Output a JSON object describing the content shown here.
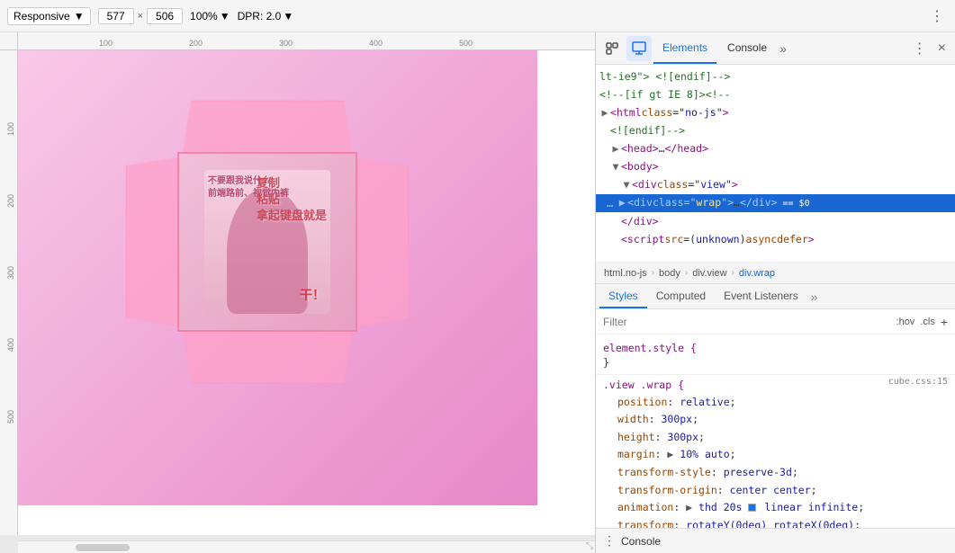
{
  "toolbar": {
    "responsive_label": "Responsive",
    "width_val": "577",
    "height_val": "506",
    "zoom_label": "100%",
    "dpr_label": "DPR: 2.0"
  },
  "devtools": {
    "tabs": [
      {
        "id": "elements",
        "label": "Elements",
        "active": true
      },
      {
        "id": "console",
        "label": "Console",
        "active": false
      }
    ],
    "more_label": "»",
    "close_label": "×",
    "html_tree": [
      {
        "indent": 0,
        "content": "lt-ie9\"> <!--[endif]-->",
        "type": "comment",
        "expanded": false
      },
      {
        "indent": 0,
        "content": "<!--[if gt IE 8]><!--",
        "type": "comment",
        "expanded": false
      },
      {
        "indent": 0,
        "tag": "html",
        "attrs": [
          {
            "name": "class",
            "val": "no-js"
          }
        ],
        "type": "open",
        "expanded": false
      },
      {
        "indent": 1,
        "content": "<!--[endif]-->",
        "type": "comment",
        "expanded": false
      },
      {
        "indent": 1,
        "tag": "head",
        "self": "…</head>",
        "type": "collapsed",
        "expanded": false
      },
      {
        "indent": 1,
        "tag": "body",
        "type": "open",
        "expanded": true,
        "toggle": "▼"
      },
      {
        "indent": 2,
        "tag": "div",
        "attrs": [
          {
            "name": "class",
            "val": "view"
          }
        ],
        "type": "open",
        "expanded": true,
        "toggle": "▼"
      },
      {
        "indent": 3,
        "tag": "div",
        "attrs": [
          {
            "name": "class",
            "val": "wrap"
          }
        ],
        "self": "…</div>",
        "type": "collapsed",
        "selected": true,
        "marker": "== $0"
      },
      {
        "indent": 2,
        "content": "</div>",
        "type": "close"
      },
      {
        "indent": 2,
        "tag": "script",
        "attrs": [
          {
            "name": "src",
            "val": "unknown"
          },
          {
            "name2": "async"
          },
          {
            "name3": "defer"
          }
        ],
        "type": "open"
      }
    ],
    "breadcrumb": [
      {
        "label": "html.no-js"
      },
      {
        "label": "body"
      },
      {
        "label": "div.view"
      },
      {
        "label": "div.wrap",
        "current": true
      }
    ],
    "styles_tabs": [
      {
        "label": "Styles",
        "active": true
      },
      {
        "label": "Computed",
        "active": false
      },
      {
        "label": "Event Listeners",
        "active": false
      }
    ],
    "filter_placeholder": "Filter",
    "filter_hov": ":hov",
    "filter_cls": ".cls",
    "filter_plus": "+",
    "css_rules": [
      {
        "selector": "element.style {",
        "close": "}",
        "props": []
      },
      {
        "selector": ".view .wrap {",
        "source": "cube.css:15",
        "close": "}",
        "props": [
          {
            "name": "position",
            "value": "relative",
            "colon": ": ",
            "semi": ";"
          },
          {
            "name": "width",
            "value": "300px",
            "colon": ": ",
            "semi": ";"
          },
          {
            "name": "height",
            "value": "300px",
            "colon": ": ",
            "semi": ";"
          },
          {
            "name": "margin",
            "value": "▶ 10% auto",
            "colon": ": ",
            "semi": ";",
            "arrow": true
          },
          {
            "name": "transform-style",
            "value": "preserve-3d",
            "colon": ": ",
            "semi": ";"
          },
          {
            "name": "transform-origin",
            "value": "center center",
            "colon": ": ",
            "semi": ";"
          },
          {
            "name": "animation",
            "value": "▶ thd 20s ◼ linear infinite",
            "colon": ": ",
            "semi": ";",
            "arrow": true,
            "swatch": "#1a73e8"
          },
          {
            "name": "transform",
            "value": "rotateY(0deg) rotateX(0deg)",
            "colon": ": ",
            "semi": ";"
          }
        ]
      }
    ],
    "console_label": "Console"
  },
  "ruler": {
    "h_ticks": [
      "100",
      "200",
      "300",
      "400",
      "500"
    ],
    "h_positions": [
      90,
      190,
      290,
      390,
      490
    ],
    "v_ticks": [
      "100",
      "200",
      "300",
      "400",
      "500"
    ],
    "v_positions": [
      80,
      160,
      240,
      320,
      400
    ]
  }
}
